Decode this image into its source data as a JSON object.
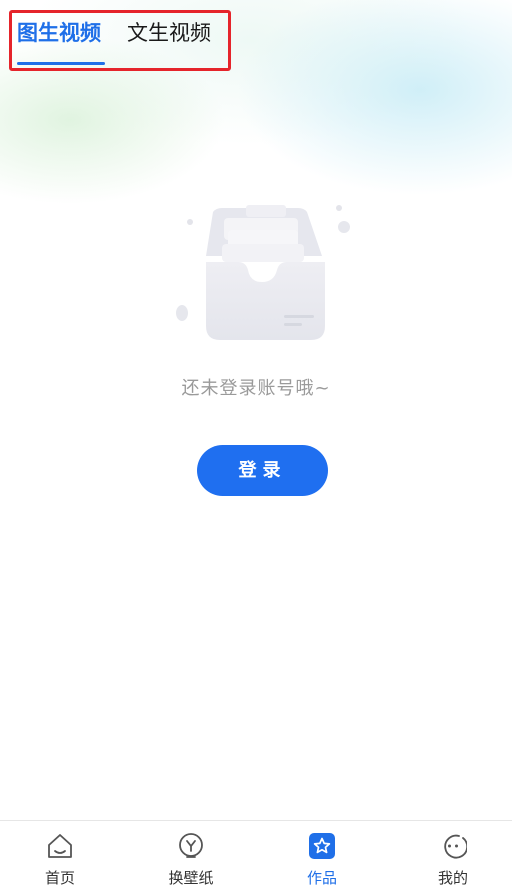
{
  "tabs": [
    {
      "label": "图生视频",
      "active": true
    },
    {
      "label": "文生视频",
      "active": false
    }
  ],
  "empty_state": {
    "message": "还未登录账号哦~",
    "button_label": "登录"
  },
  "bottom_nav": [
    {
      "label": "首页",
      "icon": "home-icon"
    },
    {
      "label": "换壁纸",
      "icon": "wallpaper-icon"
    },
    {
      "label": "作品",
      "icon": "star-icon",
      "active": true
    },
    {
      "label": "我的",
      "icon": "profile-icon"
    }
  ],
  "colors": {
    "accent": "#1f6fe8",
    "highlight_box": "#e5242b",
    "muted_text": "#9a9a9a"
  }
}
